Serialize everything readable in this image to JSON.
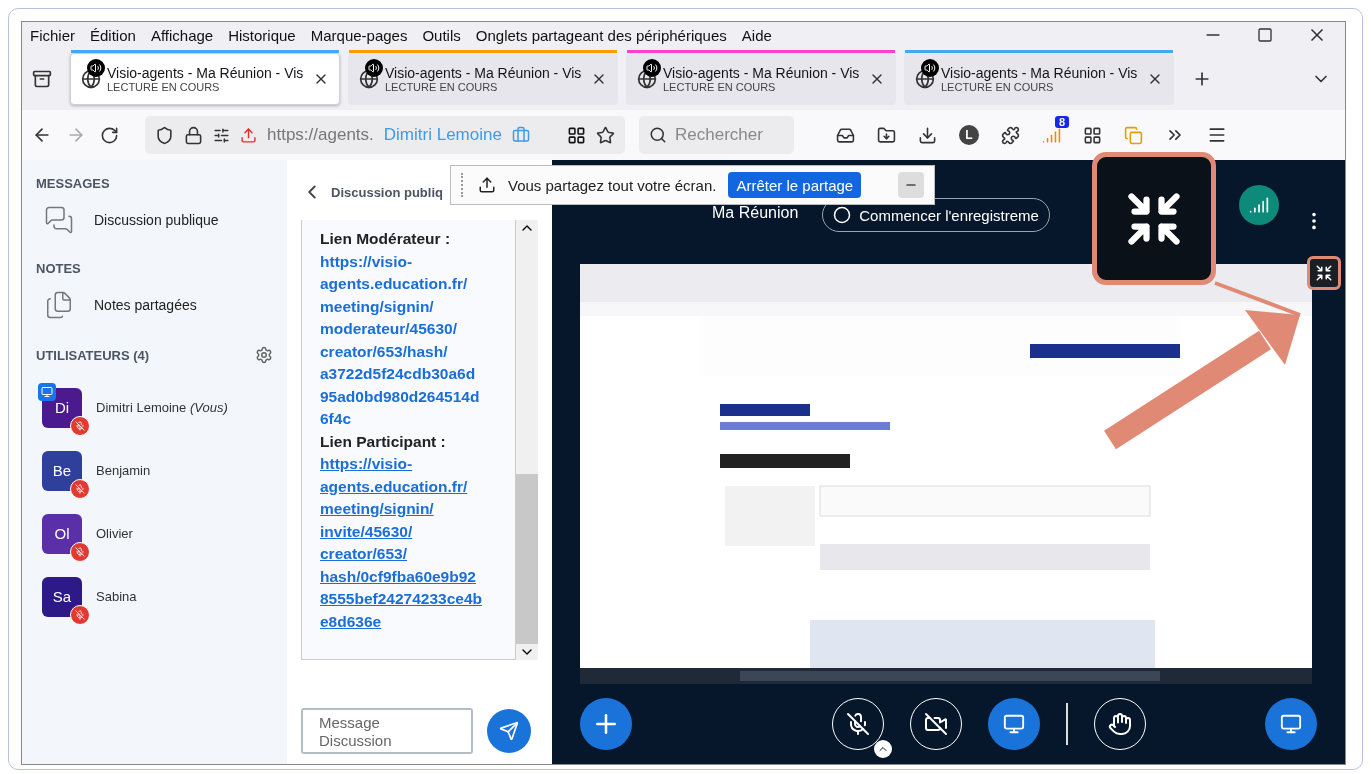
{
  "menu": [
    "Fichier",
    "Édition",
    "Affichage",
    "Historique",
    "Marque-pages",
    "Outils",
    "Onglets partageant des périphériques",
    "Aide"
  ],
  "tabs": [
    {
      "title": "Visio-agents - Ma Réunion - Vis",
      "status": "LECTURE EN COURS",
      "selected": true,
      "color": "#3fa9f5"
    },
    {
      "title": "Visio-agents - Ma Réunion - Vis",
      "status": "LECTURE EN COURS",
      "selected": false,
      "color": "#ff9a00"
    },
    {
      "title": "Visio-agents - Ma Réunion - Vis",
      "status": "LECTURE EN COURS",
      "selected": false,
      "color": "#ff3fd0"
    },
    {
      "title": "Visio-agents - Ma Réunion - Vis",
      "status": "LECTURE EN COURS",
      "selected": false,
      "color": "#3fa9f5"
    }
  ],
  "address": {
    "url": "https://agents.",
    "identity": "Dimitri Lemoine"
  },
  "search": {
    "placeholder": "Rechercher"
  },
  "extension_badge": "8",
  "profile_initial": "L",
  "share_bar": {
    "message": "Vous partagez tout votre écran.",
    "stop_button": "Arrêter le partage"
  },
  "sidebar": {
    "sections": [
      {
        "heading": "MESSAGES",
        "items": [
          {
            "kind": "chat",
            "label": "Discussion publique"
          }
        ]
      },
      {
        "heading": "NOTES",
        "items": [
          {
            "kind": "notes",
            "label": "Notes partagées"
          }
        ]
      }
    ],
    "users_heading": "UTILISATEURS (4)",
    "users": [
      {
        "initials": "Di",
        "name": "Dimitri Lemoine",
        "suffix": "(Vous)",
        "presenter": true,
        "muted": true,
        "color": "#4b1a8e"
      },
      {
        "initials": "Be",
        "name": "Benjamin",
        "presenter": false,
        "muted": true,
        "color": "#2f3f9c"
      },
      {
        "initials": "Ol",
        "name": "Olivier",
        "presenter": false,
        "muted": true,
        "color": "#5b2fa8"
      },
      {
        "initials": "Sa",
        "name": "Sabina",
        "presenter": false,
        "muted": true,
        "color": "#2d1a86"
      }
    ]
  },
  "chat": {
    "title": "Discussion publiq",
    "messages": [
      {
        "kind": "label",
        "text": "Lien Modérateur :"
      },
      {
        "kind": "link",
        "hovered": false,
        "lines": [
          "https://visio-",
          "agents.education.fr/",
          "meeting/signin/",
          "moderateur/45630/",
          "creator/653/hash/",
          "a3722d5f24cdb30a6d",
          "95ad0bd980d264514d",
          "6f4c"
        ]
      },
      {
        "kind": "label",
        "text": "Lien Participant :"
      },
      {
        "kind": "link",
        "hovered": true,
        "lines": [
          "https://visio-",
          "agents.education.fr/",
          "meeting/signin/",
          "invite/45630/",
          "creator/653/",
          "hash/0cf9fba60e9b92",
          "8555bef24274233ce4b",
          "e8d636e"
        ]
      }
    ],
    "input": {
      "placeholder": "Message Discussion"
    }
  },
  "meeting": {
    "title": "Ma Réunion",
    "record_button": "Commencer l'enregistreme",
    "controls": [
      {
        "kind": "actions",
        "active": true
      },
      {
        "kind": "mic",
        "active": false
      },
      {
        "kind": "camera",
        "active": false
      },
      {
        "kind": "screen",
        "active": true
      },
      {
        "kind": "hand",
        "active": false
      },
      {
        "kind": "presentation",
        "active": true
      }
    ]
  }
}
